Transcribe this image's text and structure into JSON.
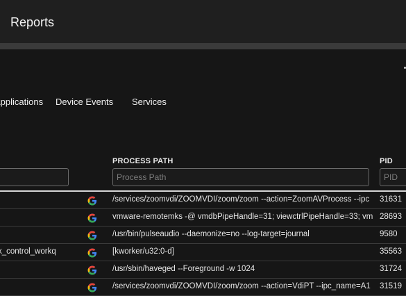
{
  "header": {
    "title": "Reports"
  },
  "tabs": [
    {
      "label": "Applications"
    },
    {
      "label": "Device Events"
    },
    {
      "label": "Services"
    }
  ],
  "columns": {
    "name": {
      "placeholder": ""
    },
    "process_path": {
      "label": "PROCESS PATH",
      "placeholder": "Process Path"
    },
    "pid": {
      "label": "PID",
      "placeholder": "PID"
    }
  },
  "rows": [
    {
      "name": "",
      "icon": "google-g-icon",
      "process_path": "/services/zoomvdi/ZOOMVDI/zoom/zoom --action=ZoomAVProcess --ipc",
      "pid": "31631"
    },
    {
      "name": "",
      "icon": "google-g-icon",
      "process_path": "vmware-remotemks -@ vmdbPipeHandle=31; viewctrlPipeHandle=33; vm",
      "pid": "28693"
    },
    {
      "name": "",
      "icon": "google-g-icon",
      "process_path": "/usr/bin/pulseaudio --daemonize=no --log-target=journal",
      "pid": "9580"
    },
    {
      "name": "k_control_workq",
      "icon": "google-g-icon",
      "process_path": "[kworker/u32:0-d]",
      "pid": "35563"
    },
    {
      "name": "",
      "icon": "google-g-icon",
      "process_path": "/usr/sbin/haveged --Foreground -w 1024",
      "pid": "31724"
    },
    {
      "name": "",
      "icon": "google-g-icon",
      "process_path": "/services/zoomvdi/ZOOMVDI/zoom/zoom --action=VdiPT --ipc_name=A1",
      "pid": "31519"
    }
  ]
}
